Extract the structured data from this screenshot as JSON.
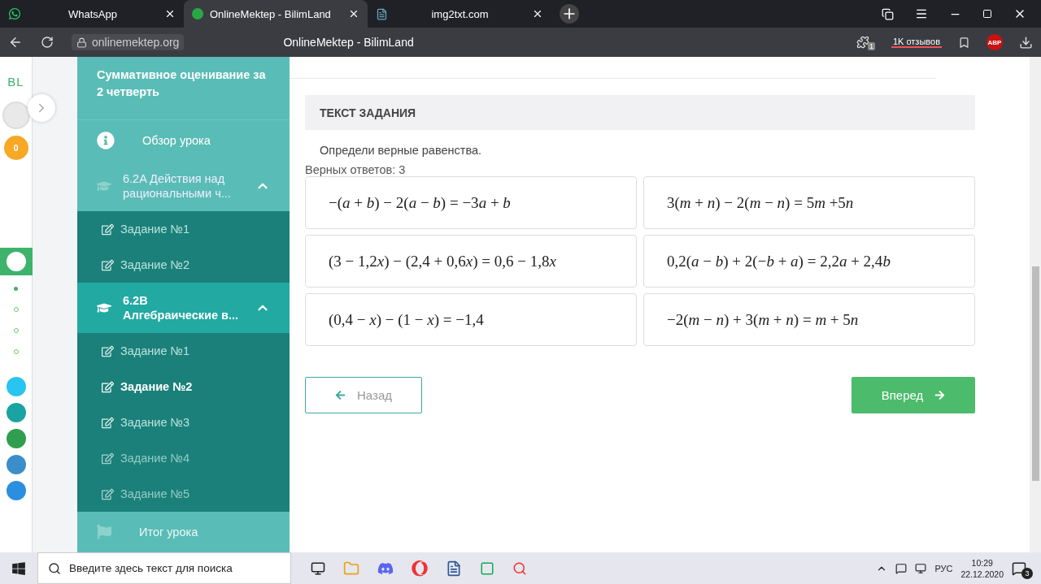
{
  "browser": {
    "tabs": [
      {
        "title": "WhatsApp",
        "selected": false,
        "kind": "chat"
      },
      {
        "title": "OnlineMektep - BilimLand",
        "selected": true,
        "kind": "site"
      },
      {
        "title": "img2txt.com",
        "selected": false,
        "kind": "doc"
      }
    ],
    "address": "onlinemektep.org",
    "page_title": "OnlineMektep - BilimLand",
    "extension_count": "1",
    "reviews": "1K отзывов",
    "adblock": "ABP"
  },
  "rail": {
    "logo": "BL",
    "coins": "0",
    "dots": [
      {
        "selected": true
      },
      {
        "selected": false
      },
      {
        "selected": false
      },
      {
        "selected": false
      }
    ]
  },
  "sidebar": {
    "header": "Суммативное оценивание за 2 четверть",
    "overview": "Обзор урока",
    "sections": [
      {
        "title": "6.2A Действия над рациональными ч...",
        "selected": false,
        "expanded": true,
        "items": [
          {
            "label": "Задание №1",
            "selected": false,
            "faded": false
          },
          {
            "label": "Задание №2",
            "selected": false,
            "faded": false
          }
        ]
      },
      {
        "title": "6.2B Алгебраические в...",
        "selected": true,
        "expanded": true,
        "items": [
          {
            "label": "Задание №1",
            "selected": false,
            "faded": false
          },
          {
            "label": "Задание №2",
            "selected": true,
            "faded": false
          },
          {
            "label": "Задание №3",
            "selected": false,
            "faded": false
          },
          {
            "label": "Задание №4",
            "selected": false,
            "faded": true
          },
          {
            "label": "Задание №5",
            "selected": false,
            "faded": true
          }
        ]
      }
    ],
    "final": "Итог урока"
  },
  "task": {
    "heading": "ТЕКСТ ЗАДАНИЯ",
    "instruction": "Определи верные равенства.",
    "answers_count": "Верных ответов: 3",
    "options": [
      "−(a + b) − 2(a − b) = −3a + b",
      "3(m + n) − 2(m − n) = 5m +5n",
      "(3 − 1,2x) − (2,4 + 0,6x) = 0,6 − 1,8x",
      "0,2(a − b) + 2(−b + a) = 2,2a + 2,4b",
      "(0,4 − x) − (1 − x) = −1,4",
      "−2(m − n) + 3(m + n) = m + 5n"
    ],
    "back": "Назад",
    "next": "Вперед"
  },
  "taskbar": {
    "search_placeholder": "Введите здесь текст для поиска",
    "language": "РУС",
    "time": "10:29",
    "date": "22.12.2020",
    "notifications": "3"
  }
}
